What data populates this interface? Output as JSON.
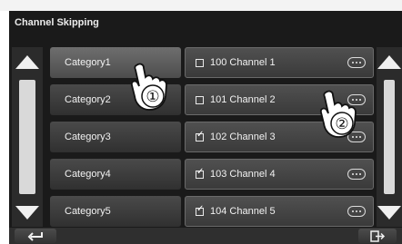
{
  "screen": {
    "title": "Channel Skipping"
  },
  "categories": [
    {
      "label": "Category1",
      "selected": true
    },
    {
      "label": "Category2",
      "selected": false
    },
    {
      "label": "Category3",
      "selected": false
    },
    {
      "label": "Category4",
      "selected": false
    },
    {
      "label": "Category5",
      "selected": false
    }
  ],
  "channels": [
    {
      "label": "100 Channel 1",
      "checked": false
    },
    {
      "label": "101 Channel 2",
      "checked": false
    },
    {
      "label": "102 Channel 3",
      "checked": true
    },
    {
      "label": "103 Channel 4",
      "checked": true
    },
    {
      "label": "104 Channel 5",
      "checked": true
    }
  ],
  "icons": {
    "scroll_up": "triangle-up-icon",
    "scroll_down": "triangle-down-icon",
    "more": "ellipsis-icon",
    "back": "return-arrow-icon",
    "exit": "exit-door-icon",
    "hand": "pointing-hand-icon"
  },
  "callouts": [
    {
      "label": "①"
    },
    {
      "label": "②"
    }
  ]
}
